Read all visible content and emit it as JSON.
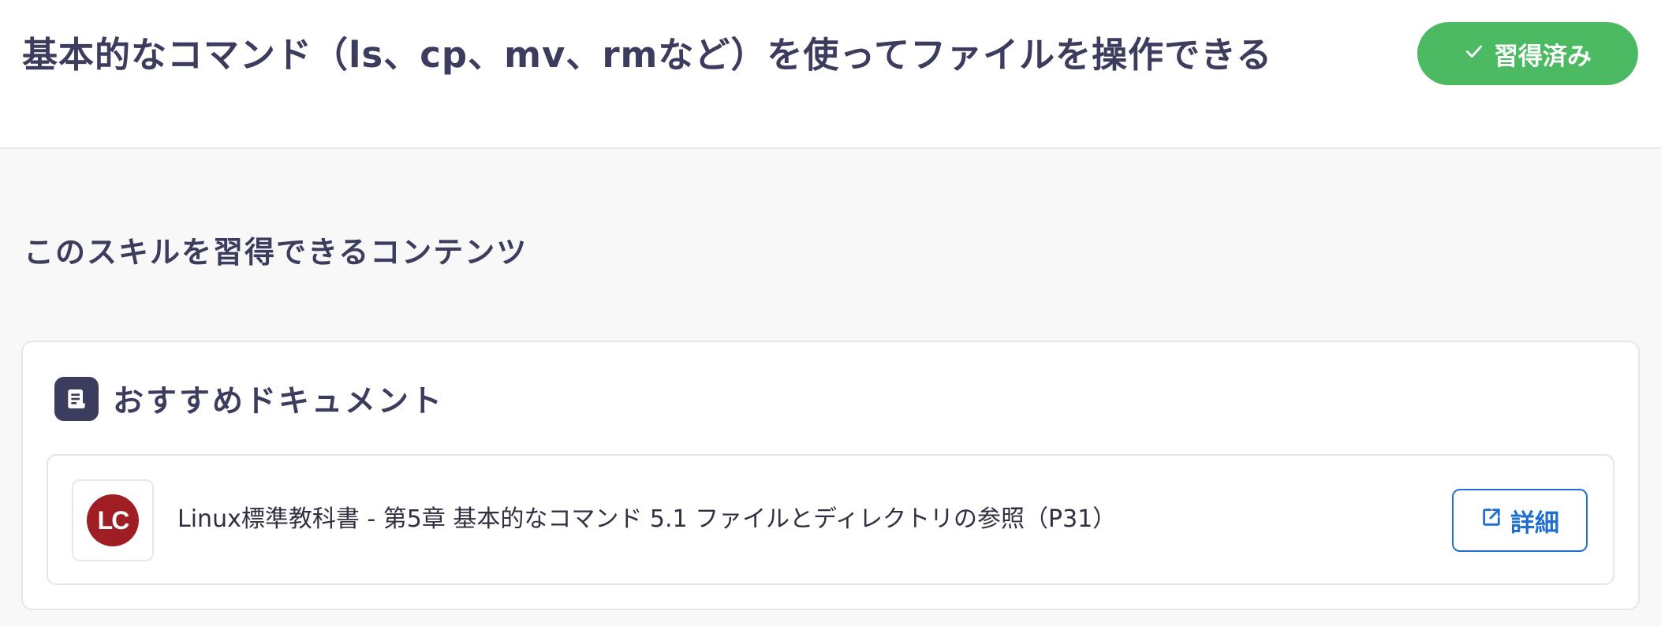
{
  "skill": {
    "title": "基本的なコマンド（ls、cp、mv、rmなど）を使ってファイルを操作できる",
    "status_label": "習得済み"
  },
  "section": {
    "heading": "このスキルを習得できるコンテンツ"
  },
  "recommended_documents": {
    "title": "おすすめドキュメント",
    "items": [
      {
        "logo_text": "LC",
        "title": "Linux標準教科書 - 第5章 基本的なコマンド 5.1 ファイルとディレクトリの参照（P31）",
        "detail_label": "詳細"
      }
    ]
  },
  "colors": {
    "accent_green": "#4cb963",
    "link_blue": "#1f6fd1",
    "heading_navy": "#3c3d5e",
    "logo_red": "#9e1e24"
  },
  "icons": {
    "status": "check-icon",
    "section": "document-icon",
    "detail": "external-link-icon"
  }
}
